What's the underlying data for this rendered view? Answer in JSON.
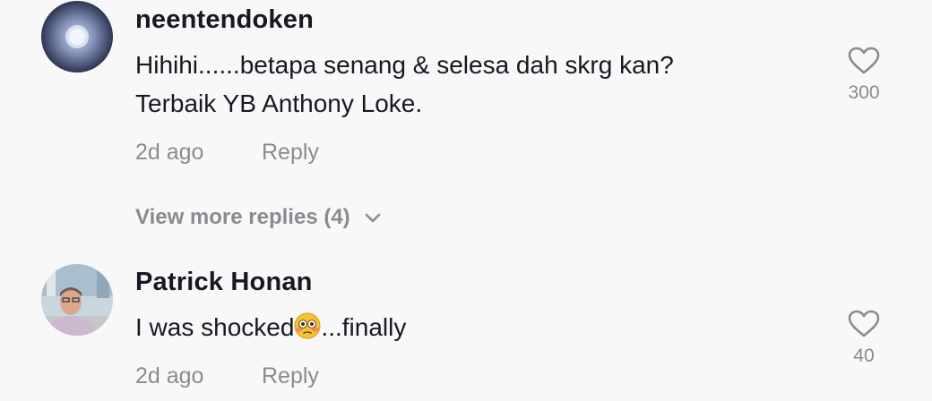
{
  "comments": [
    {
      "username": "neentendoken",
      "text_lines": [
        "Hihihi......betapa senang & selesa dah skrg kan?",
        "Terbaik YB Anthony Loke."
      ],
      "time": "2d ago",
      "reply_label": "Reply",
      "likes": "300"
    },
    {
      "username": "Patrick Honan",
      "text_before_emoji": "I was shocked",
      "emoji": "flushed-face",
      "text_after_emoji": "...finally",
      "time": "2d ago",
      "reply_label": "Reply",
      "likes": "40"
    }
  ],
  "view_more_replies": "View more replies (4)",
  "icons": {
    "like": "heart-outline-icon",
    "expand": "chevron-down-icon"
  },
  "colors": {
    "background": "#f8f8f8",
    "primary_text": "#161823",
    "secondary_text": "#8a8b91"
  }
}
